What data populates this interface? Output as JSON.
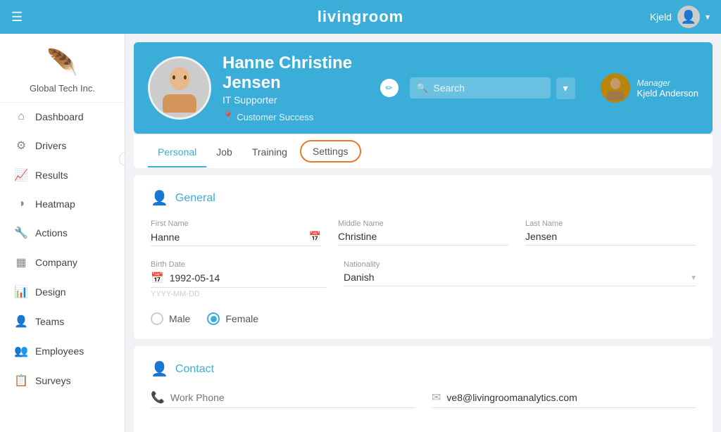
{
  "app": {
    "title": "livingroom"
  },
  "navbar": {
    "user": "Kjeld",
    "hamburger_label": "☰"
  },
  "sidebar": {
    "company_name": "Global Tech Inc.",
    "collapse_icon": "‹",
    "items": [
      {
        "id": "dashboard",
        "label": "Dashboard",
        "icon": "⌂"
      },
      {
        "id": "drivers",
        "label": "Drivers",
        "icon": "⚙"
      },
      {
        "id": "results",
        "label": "Results",
        "icon": "📈"
      },
      {
        "id": "heatmap",
        "label": "Heatmap",
        "icon": "◑"
      },
      {
        "id": "actions",
        "label": "Actions",
        "icon": "🔧"
      },
      {
        "id": "company",
        "label": "Company",
        "icon": "▦"
      },
      {
        "id": "design",
        "label": "Design",
        "icon": "📊"
      },
      {
        "id": "teams",
        "label": "Teams",
        "icon": "👤"
      },
      {
        "id": "employees",
        "label": "Employees",
        "icon": "👥"
      },
      {
        "id": "surveys",
        "label": "Surveys",
        "icon": "📋"
      }
    ]
  },
  "profile": {
    "name": "Hanne Christine Jensen",
    "title": "IT Supporter",
    "location": "Customer Success",
    "search_placeholder": "Search",
    "manager_label": "Manager",
    "manager_name": "Kjeld Anderson"
  },
  "tabs": [
    {
      "id": "personal",
      "label": "Personal",
      "active": true
    },
    {
      "id": "job",
      "label": "Job"
    },
    {
      "id": "training",
      "label": "Training"
    },
    {
      "id": "settings",
      "label": "Settings",
      "highlighted": true
    }
  ],
  "general_section": {
    "title": "General",
    "fields": {
      "first_name_label": "First Name",
      "first_name_value": "Hanne",
      "middle_name_label": "Middle Name",
      "middle_name_value": "Christine",
      "last_name_label": "Last Name",
      "last_name_value": "Jensen",
      "birth_date_label": "Birth Date",
      "birth_date_value": "1992-05-14",
      "birth_date_placeholder": "YYYY-MM-DD",
      "nationality_label": "Nationality",
      "nationality_value": "Danish"
    },
    "gender": {
      "male_label": "Male",
      "female_label": "Female",
      "selected": "female"
    }
  },
  "contact_section": {
    "title": "Contact",
    "fields": {
      "work_phone_label": "Work Phone",
      "work_phone_placeholder": "Work Phone",
      "email_label": "Email",
      "email_value": "ve8@livingroomanalytics.com"
    }
  }
}
